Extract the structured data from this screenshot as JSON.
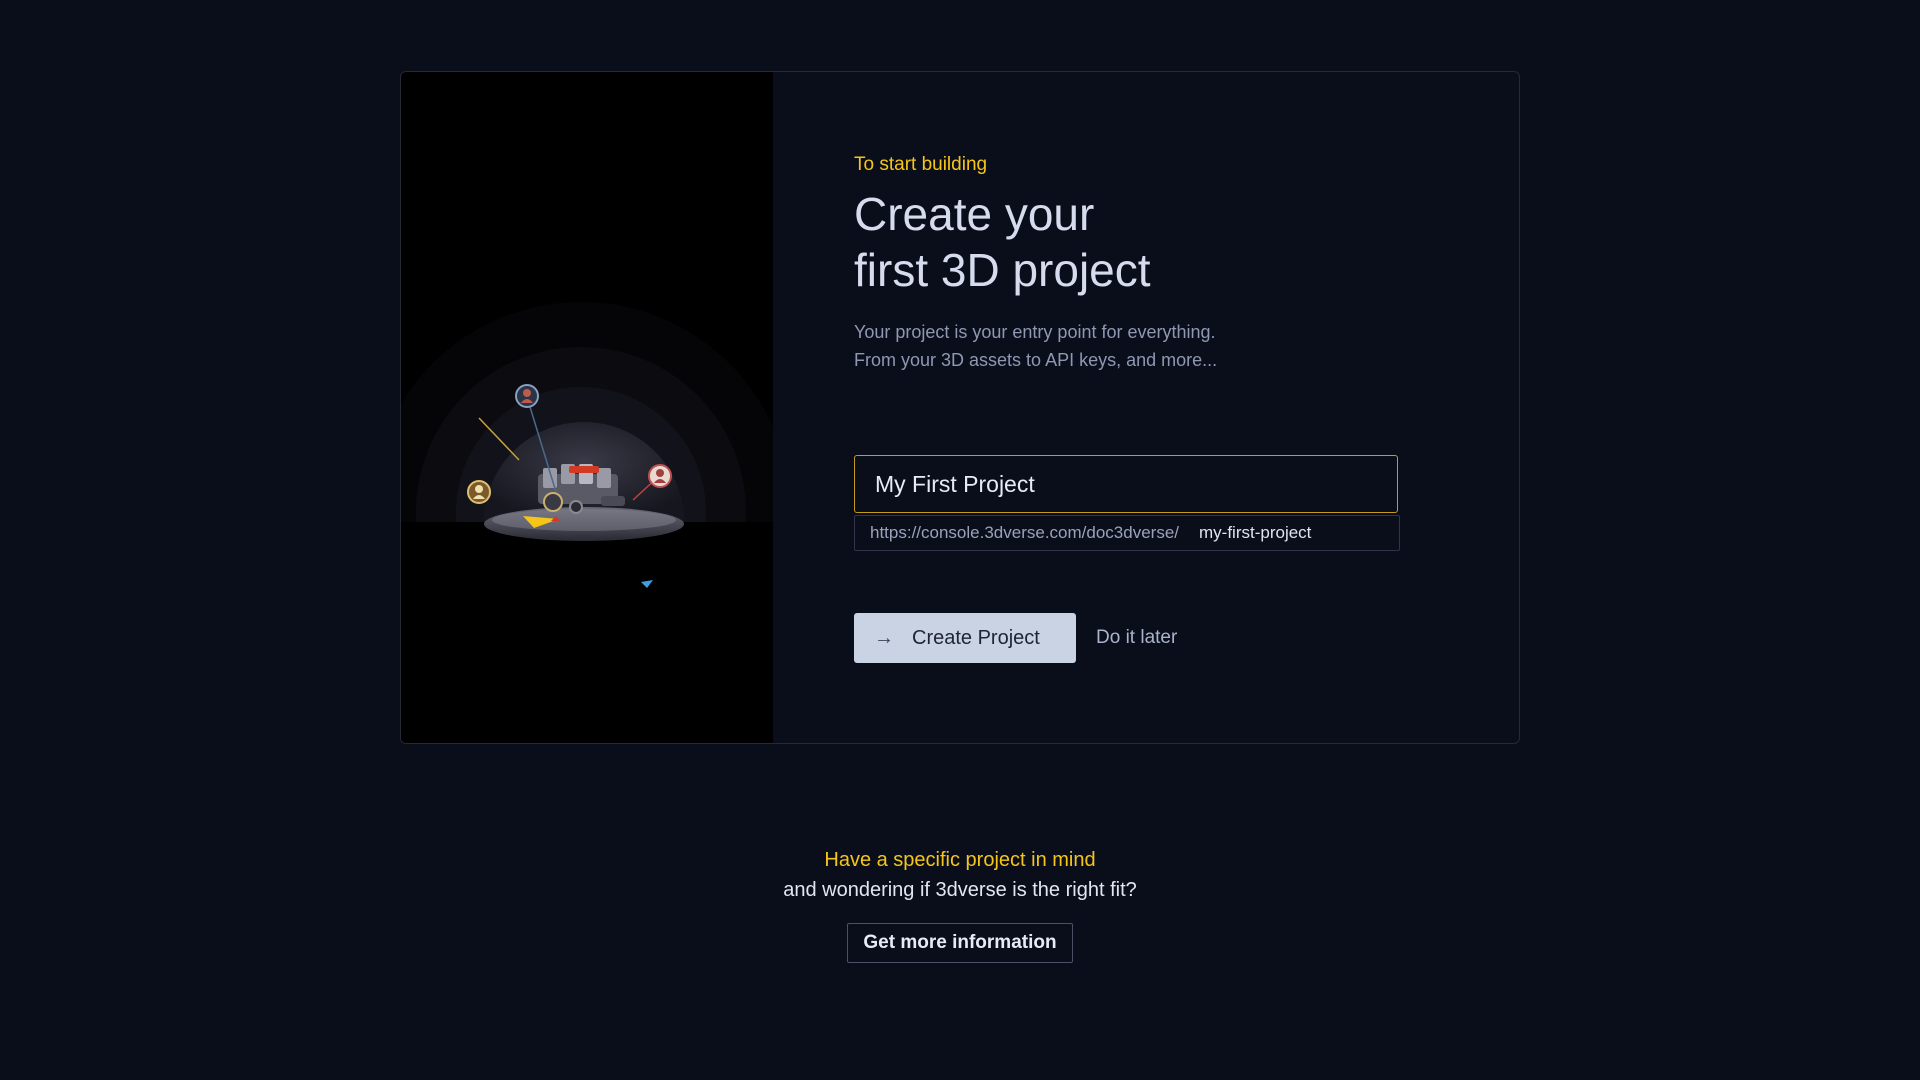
{
  "onboarding": {
    "eyebrow": "To start building",
    "title_line1": "Create your",
    "title_line2": "first 3D project",
    "desc_line1": "Your project is your entry point for everything.",
    "desc_line2": "From your 3D assets to API keys, and more...",
    "project_name": "My First Project",
    "url_prefix": "https://console.3dverse.com/doc3dverse/",
    "url_slug": "my-first-project",
    "create_label": "Create Project",
    "later_label": "Do it later"
  },
  "footer": {
    "highlight": "Have a specific project in mind",
    "subtitle": "and wondering if 3dverse is the right fit?",
    "info_label": "Get more information"
  },
  "colors": {
    "accent": "#f5c518",
    "background": "#0a0e1a",
    "button_bg": "#c9d3e3"
  },
  "icons": {
    "create": "arrow-right-icon"
  }
}
